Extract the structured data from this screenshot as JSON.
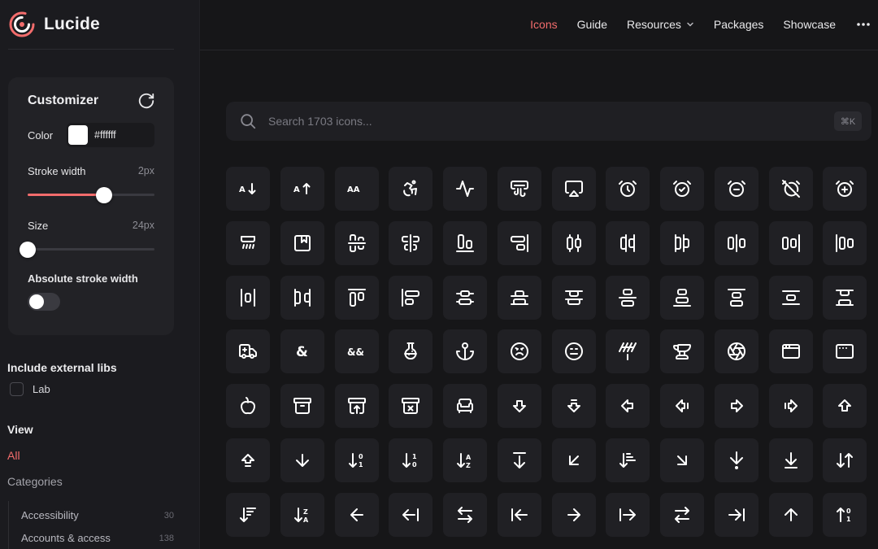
{
  "brand": {
    "name": "Lucide"
  },
  "nav": {
    "items": [
      {
        "label": "Icons",
        "active": true
      },
      {
        "label": "Guide"
      },
      {
        "label": "Resources",
        "has_dropdown": true
      },
      {
        "label": "Packages"
      },
      {
        "label": "Showcase"
      }
    ],
    "more_icon": "more-horizontal-icon"
  },
  "customizer": {
    "title": "Customizer",
    "reset_icon": "rotate-cw-icon",
    "color_label": "Color",
    "color_value": "#ffffff",
    "stroke_label": "Stroke width",
    "stroke_value": "2px",
    "stroke_fraction": 0.6,
    "size_label": "Size",
    "size_value": "24px",
    "size_fraction": 0.0,
    "absolute_label": "Absolute stroke width",
    "absolute_on": false
  },
  "external_libs": {
    "title": "Include external libs",
    "items": [
      {
        "label": "Lab",
        "checked": false
      }
    ]
  },
  "view": {
    "title": "View",
    "all_label": "All",
    "categories_label": "Categories",
    "categories": [
      {
        "name": "Accessibility",
        "count": "30"
      },
      {
        "name": "Accounts & access",
        "count": "138"
      }
    ]
  },
  "search": {
    "placeholder": "Search 1703 icons...",
    "shortcut": "⌘K",
    "icon": "search-icon"
  },
  "icons": [
    "arrow-down-a-z-icon",
    "a-arrow-up-icon",
    "case-sensitive-icon",
    "accessibility-icon",
    "activity-icon",
    "air-vent-icon",
    "airplay-icon",
    "alarm-clock-icon",
    "alarm-clock-check-icon",
    "alarm-clock-minus-icon",
    "alarm-clock-off-icon",
    "alarm-clock-plus-icon",
    "alarm-smoke-icon",
    "album-icon",
    "align-center-horizontal-icon",
    "align-center-vertical-icon",
    "align-end-horizontal-icon",
    "align-end-vertical-icon",
    "align-horizontal-distribute-center-icon",
    "align-horizontal-distribute-end-icon",
    "align-horizontal-distribute-start-icon",
    "align-horizontal-justify-center-icon",
    "align-horizontal-justify-end-icon",
    "align-horizontal-justify-start-icon",
    "align-horizontal-space-around-icon",
    "align-horizontal-space-between-icon",
    "align-start-horizontal-icon",
    "align-start-vertical-icon",
    "align-vertical-distribute-center-icon",
    "align-vertical-distribute-end-icon",
    "align-vertical-distribute-start-icon",
    "align-vertical-justify-center-icon",
    "align-vertical-justify-end-icon",
    "align-vertical-justify-start-icon",
    "align-vertical-space-around-icon",
    "align-vertical-space-between-icon",
    "ambulance-icon",
    "ampersand-icon",
    "ampersands-icon",
    "amphora-icon",
    "anchor-icon",
    "angry-icon",
    "annoyed-icon",
    "antenna-icon",
    "anvil-icon",
    "aperture-icon",
    "app-window-icon",
    "app-window-mac-icon",
    "apple-icon",
    "archive-icon",
    "archive-restore-icon",
    "archive-x-icon",
    "armchair-icon",
    "arrow-big-down-icon",
    "arrow-big-down-dash-icon",
    "arrow-big-left-icon",
    "arrow-big-left-dash-icon",
    "arrow-big-right-icon",
    "arrow-big-right-dash-icon",
    "arrow-big-up-icon",
    "arrow-big-up-dash-icon",
    "arrow-down-icon",
    "arrow-down-0-1-icon",
    "arrow-down-1-0-icon",
    "arrow-down-a-z-icon",
    "arrow-down-from-line-icon",
    "arrow-down-left-icon",
    "arrow-down-narrow-wide-icon",
    "arrow-down-right-icon",
    "arrow-down-to-dot-icon",
    "arrow-down-to-line-icon",
    "arrow-down-up-icon",
    "arrow-down-wide-narrow-icon",
    "arrow-down-z-a-icon",
    "arrow-left-icon",
    "arrow-left-from-line-icon",
    "arrow-left-right-icon",
    "arrow-left-to-line-icon",
    "arrow-right-icon",
    "arrow-right-from-line-icon",
    "arrow-right-left-icon",
    "arrow-right-to-line-icon",
    "arrow-up-icon",
    "arrow-up-0-1-icon"
  ]
}
